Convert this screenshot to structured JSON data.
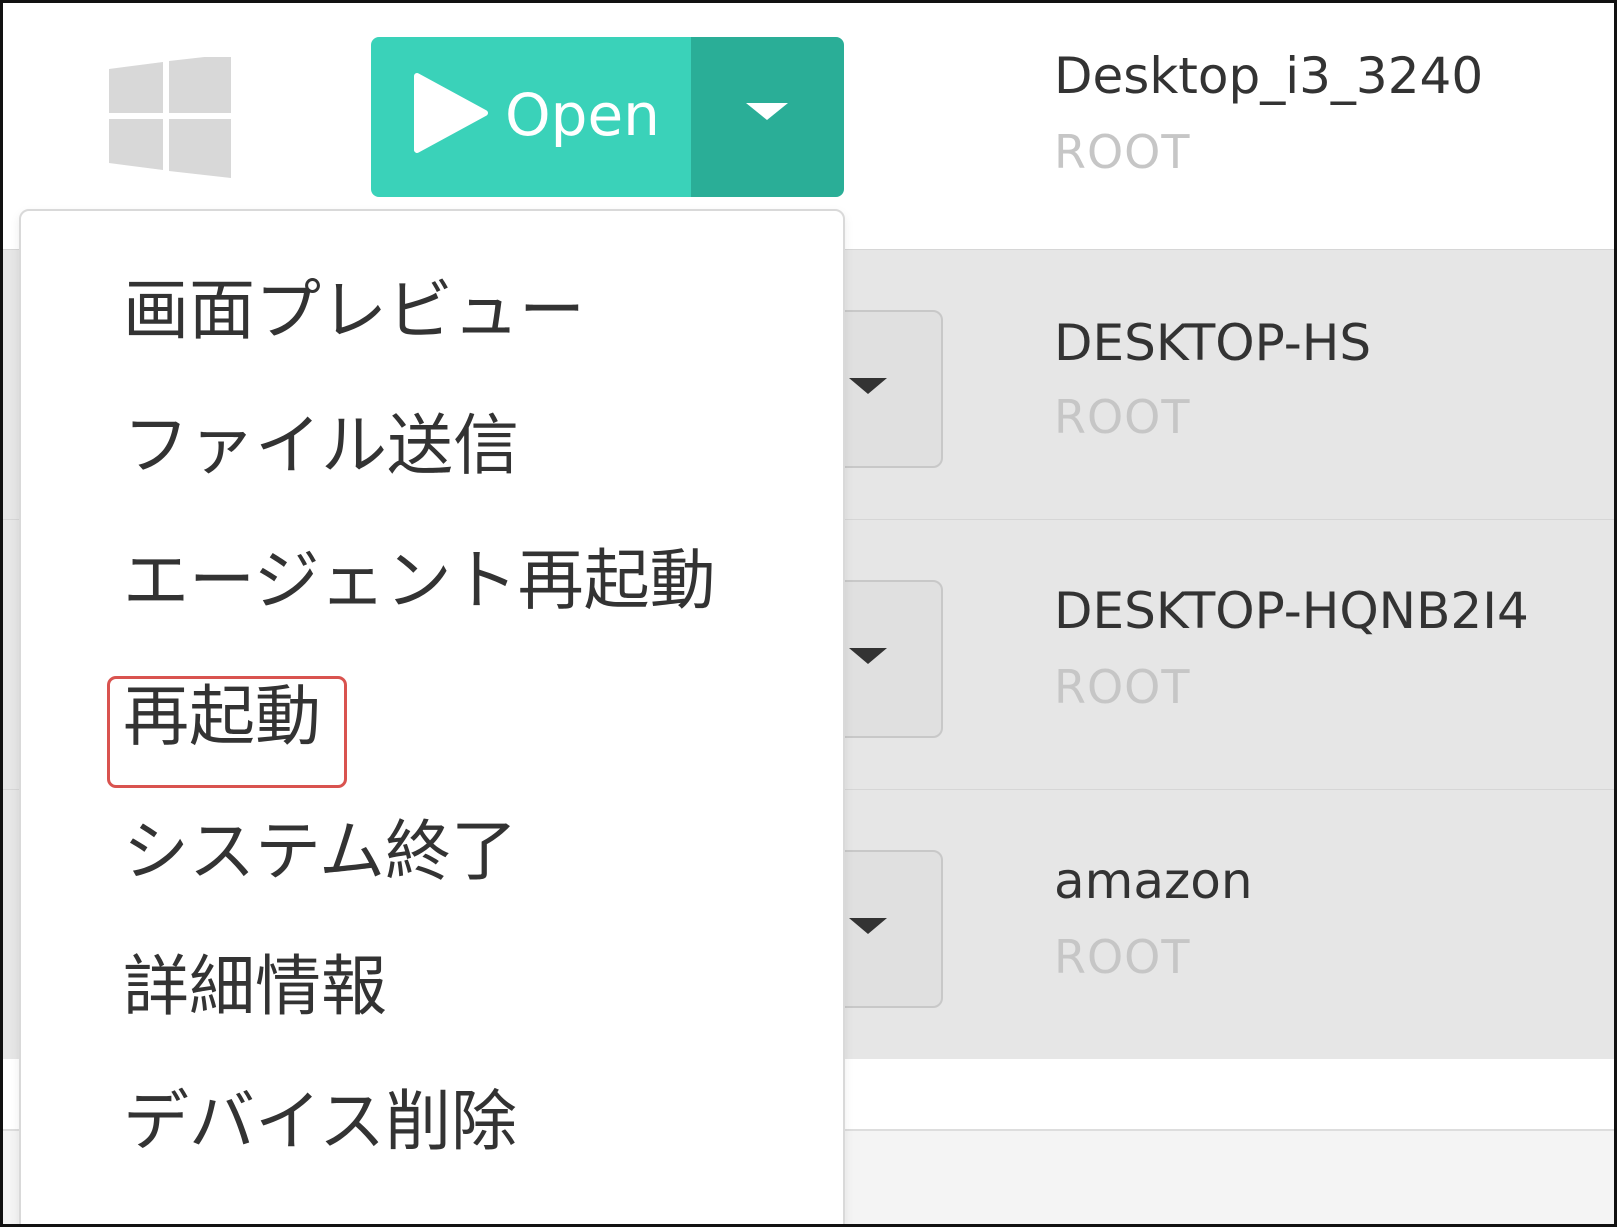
{
  "open_button": {
    "label": "Open",
    "primary_color": "#3ad2b9",
    "toggle_color": "#2aae97"
  },
  "devices": [
    {
      "name": "Desktop_i3_3240",
      "group": "ROOT"
    },
    {
      "name": "DESKTOP-HS",
      "group": "ROOT"
    },
    {
      "name": "DESKTOP-HQNB2I4",
      "group": "ROOT"
    },
    {
      "name": "amazon",
      "group": "ROOT"
    }
  ],
  "menu": {
    "items": [
      {
        "label": "画面プレビュー"
      },
      {
        "label": "ファイル送信"
      },
      {
        "label": "エージェント再起動"
      },
      {
        "label": "再起動",
        "highlighted": true
      },
      {
        "label": "システム終了"
      },
      {
        "label": "詳細情報"
      },
      {
        "label": "デバイス削除"
      }
    ],
    "highlight_color": "#d9534f"
  },
  "icons": {
    "os": "windows-logo-icon",
    "play": "play-icon",
    "caret": "caret-down-icon"
  }
}
